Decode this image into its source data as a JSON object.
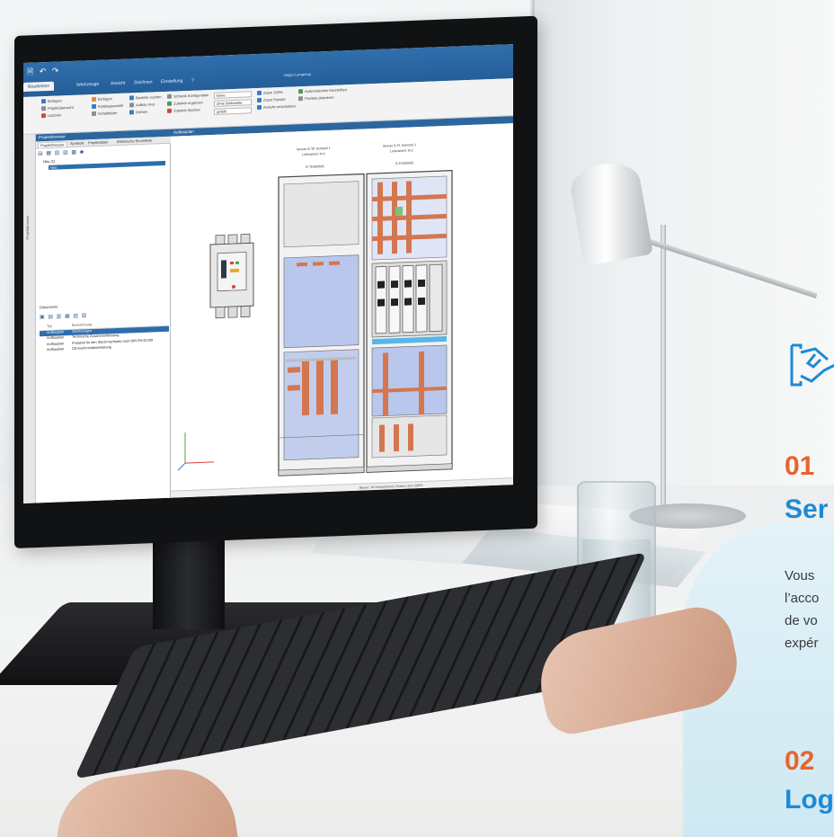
{
  "software": {
    "quick_access": "🗎 ↶ ↷",
    "tabs": [
      "Bearbeiten",
      "Werkzeuge",
      "Ansicht",
      "Zeichnen",
      "Einstellung",
      "?"
    ],
    "active_tab_index": 0,
    "app_title": "Hager Lamgroup",
    "ribbon": {
      "g1": [
        "Einfügen",
        "Projektübersicht",
        "Löschen"
      ],
      "g2": [
        "Einfügen",
        "Katalogauswahl",
        "Schaltfelder"
      ],
      "g3": [
        "Bauteile suchen",
        "Aufbau mvo",
        "Drehen"
      ],
      "g4": [
        "Schrank Konfiguration",
        "Zubehör ergänzen",
        "Zubehör löschen"
      ],
      "g5_inputs": [
        "keine",
        "ohne Bildinhalte",
        "gefällt"
      ],
      "g6": [
        "Zoom 100%",
        "Zoom Fenster",
        "Ansicht verschieben"
      ],
      "g7": [
        "Automatisches beschriften",
        "Position platzieren"
      ]
    },
    "side_label": "Projektbrowser",
    "panel": {
      "title": "Projektbrowser",
      "tabs": [
        "Projektbrowser",
        "Symbole",
        "Projektdaten",
        "Elektrische Einzelteile"
      ],
      "tree": [
        "Neu (1)",
        "Neu"
      ],
      "documents_title": "Dokumente",
      "doc_columns": [
        "Typ",
        "Bezeichnung"
      ],
      "doc_rows": [
        {
          "type": "Aufbauplan",
          "name": "Zeichnungen"
        },
        {
          "type": "Aufbauplan",
          "name": "Technische Zusammenfassung"
        },
        {
          "type": "Aufbauplan",
          "name": "Protokoll für den Stückrnachweis nach DIN EN 61439"
        },
        {
          "type": "Aufbauplan",
          "name": "CE-Konformitätserklärung"
        }
      ]
    },
    "canvas_title": "Aufbauplan",
    "cabinet_left": {
      "line1": "Sineas G-TE Schrank 1",
      "line2": "Lieferanteil: M.V",
      "code": "G-TE800505"
    },
    "cabinet_right": {
      "line1": "Sineas G-FL Schrank 2",
      "line2": "Lieferanteil: M.2",
      "code": "G-FL800505"
    },
    "status": "Bauen: 10-Schrankmont  | Sortier  | 0,0  | 100%"
  },
  "overlay": {
    "item1": {
      "number": "01",
      "title": "Ser",
      "text": [
        "Vous",
        "l’acco",
        "de vo",
        "expér"
      ]
    },
    "item2": {
      "number": "02",
      "title": "Log"
    },
    "colors": {
      "number": "#e8632e",
      "title": "#1d8ad6",
      "icon": "#1d8ad6"
    },
    "icon_name": "handshake-icon"
  }
}
